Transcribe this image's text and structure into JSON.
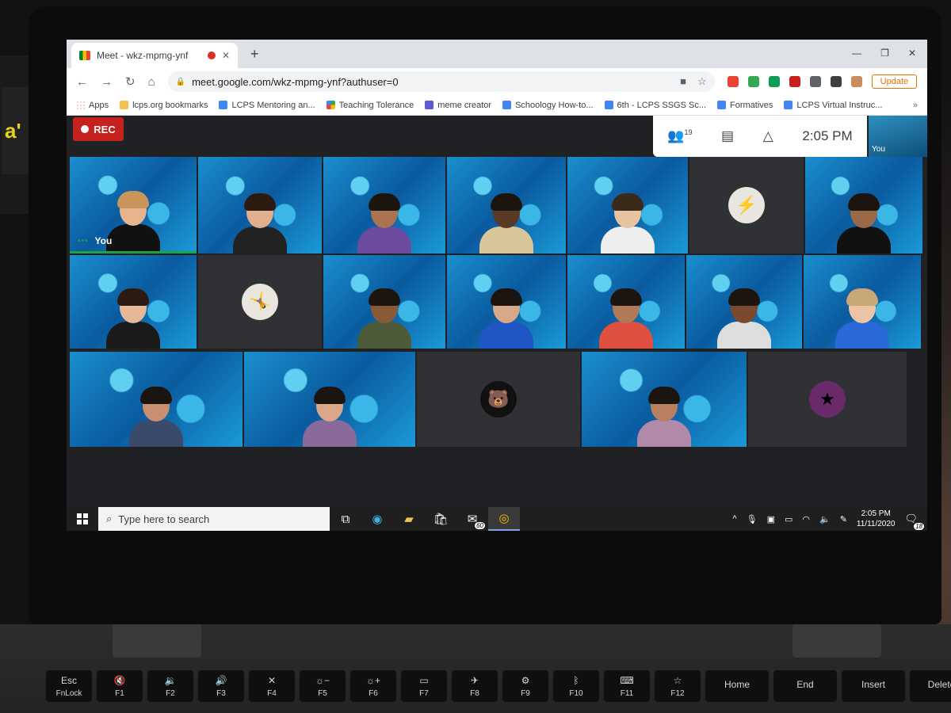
{
  "tab": {
    "title": "Meet - wkz-mpmg-ynf"
  },
  "address": {
    "url": "meet.google.com/wkz-mpmg-ynf?authuser=0",
    "update_label": "Update"
  },
  "bookmarks": [
    "Apps",
    "lcps.org bookmarks",
    "LCPS Mentoring an...",
    "Teaching Tolerance",
    "meme creator",
    "Schoology How-to...",
    "6th - LCPS SSGS Sc...",
    "Formatives",
    "LCPS Virtual Instruc..."
  ],
  "meet": {
    "rec_label": "REC",
    "participants_count": "19",
    "time": "2:05 PM",
    "self_label": "You",
    "tile_you_label": "You"
  },
  "taskbar": {
    "search_placeholder": "Type here to search",
    "mail_badge": "60",
    "clock_time": "2:05 PM",
    "clock_date": "11/11/2020",
    "notif_count": "18"
  },
  "keyboard": [
    {
      "top": "Esc",
      "bottom": "FnLock"
    },
    {
      "top": "🔇",
      "bottom": "F1"
    },
    {
      "top": "🔉",
      "bottom": "F2"
    },
    {
      "top": "🔊",
      "bottom": "F3"
    },
    {
      "top": "✕",
      "bottom": "F4"
    },
    {
      "top": "☼−",
      "bottom": "F5"
    },
    {
      "top": "☼+",
      "bottom": "F6"
    },
    {
      "top": "▭",
      "bottom": "F7"
    },
    {
      "top": "✈",
      "bottom": "F8"
    },
    {
      "top": "⚙",
      "bottom": "F9"
    },
    {
      "top": "ᛒ",
      "bottom": "F10"
    },
    {
      "top": "⌨",
      "bottom": "F11"
    },
    {
      "top": "☆",
      "bottom": "F12"
    },
    {
      "top": "Home",
      "bottom": ""
    },
    {
      "top": "End",
      "bottom": ""
    },
    {
      "top": "Insert",
      "bottom": ""
    },
    {
      "top": "Delete",
      "bottom": ""
    }
  ],
  "colors": {
    "rec": "#c5221f",
    "speaking": "#1ea446",
    "tile_bg": "#1a8fcf"
  }
}
